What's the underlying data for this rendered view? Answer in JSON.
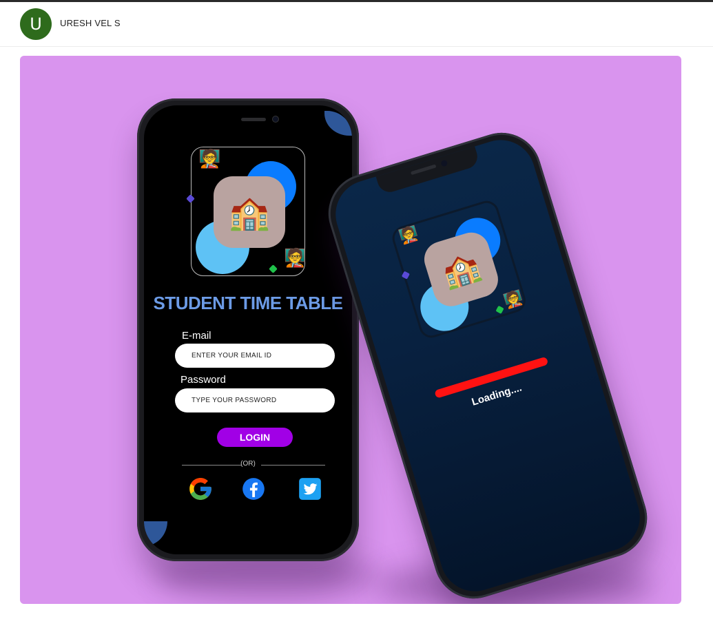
{
  "header": {
    "avatar_letter": "U",
    "author_name": "URESH VEL S",
    "avatar_color": "#2e6b1c"
  },
  "shot": {
    "background": "#d994ee",
    "login_screen": {
      "app_title": "STUDENT TIME TABLE",
      "logo_icons": [
        "teacher-emoji-icon",
        "school-emoji-icon",
        "teacher-emoji-icon"
      ],
      "email_label": "E-mail",
      "email_placeholder": "ENTER YOUR EMAIL ID",
      "password_label": "Password",
      "password_placeholder": "TYPE YOUR PASSWORD",
      "login_label": "LOGIN",
      "or_text": "(OR)",
      "social_icons": [
        "google-icon",
        "facebook-icon",
        "twitter-icon"
      ]
    },
    "loading_screen": {
      "loading_text": "Loading....",
      "progress": 1.0,
      "progress_color": "#ff1212"
    },
    "colors": {
      "title": "#6c9be6",
      "login_button": "#a100e6",
      "blob_blue": "#0a7cff",
      "blob_light": "#5ec2f5",
      "tile": "#b9a3a0"
    },
    "emoji": {
      "school": "🏫",
      "teacher": "🧑‍🏫"
    }
  }
}
